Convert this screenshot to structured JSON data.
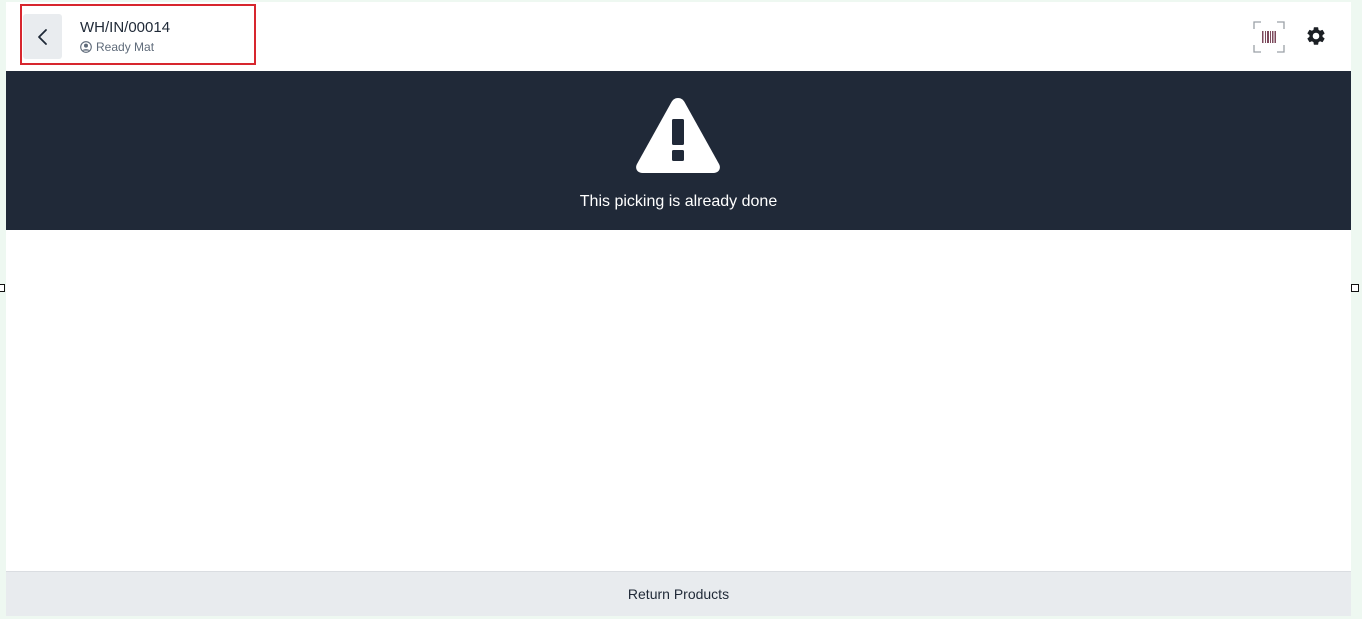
{
  "header": {
    "title": "WH/IN/00014",
    "partner": "Ready Mat"
  },
  "banner": {
    "message": "This picking is already done"
  },
  "footer": {
    "return_label": "Return Products"
  },
  "icons": {
    "back": "chevron-left-icon",
    "partner": "user-circle-icon",
    "barcode": "barcode-scan-icon",
    "settings": "gear-icon",
    "warning": "warning-triangle-icon"
  },
  "colors": {
    "banner_bg": "#202938",
    "highlight": "#d7262e",
    "footer_bg": "#e8ebee"
  }
}
